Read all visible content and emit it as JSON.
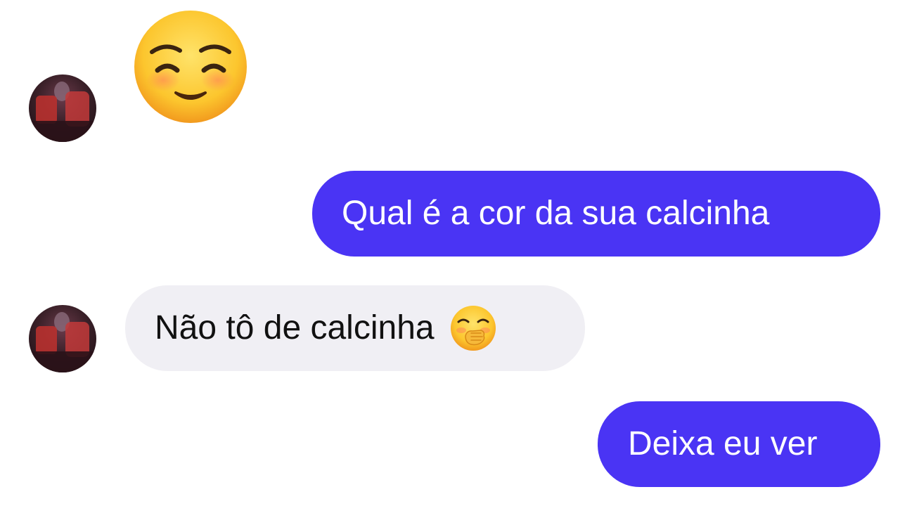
{
  "conversation": {
    "messages": [
      {
        "sender": "contact",
        "type": "emoji",
        "icon": "smiling-face-with-smiling-eyes-icon"
      },
      {
        "sender": "me",
        "type": "text",
        "text": "Qual é a cor da sua calcinha"
      },
      {
        "sender": "contact",
        "type": "text",
        "text": "Não tô de calcinha",
        "icon": "face-with-hand-over-mouth-icon"
      },
      {
        "sender": "me",
        "type": "text",
        "text": "Deixa eu ver"
      }
    ]
  },
  "colors": {
    "outgoing_bubble": "#4a34f4",
    "incoming_bubble": "#f0eff4",
    "background": "#ffffff"
  }
}
